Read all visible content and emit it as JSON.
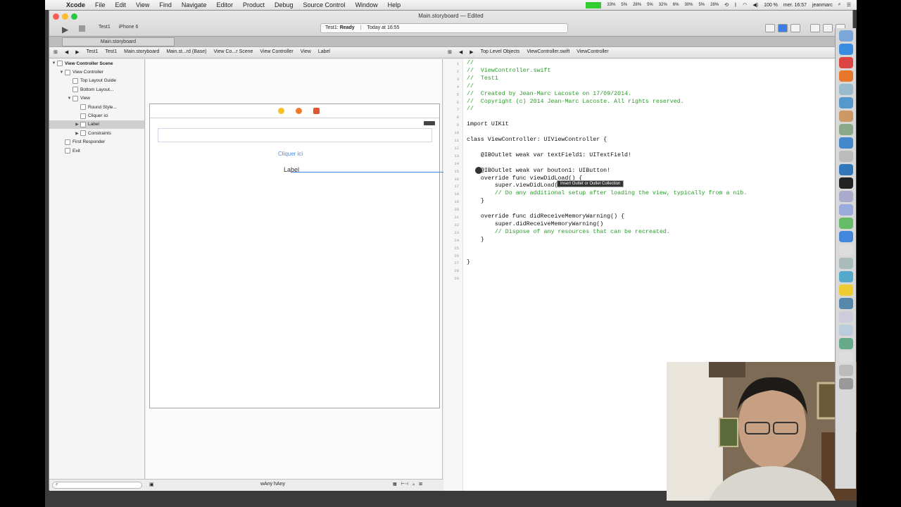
{
  "menubar": {
    "app": "Xcode",
    "items": [
      "File",
      "Edit",
      "View",
      "Find",
      "Navigate",
      "Editor",
      "Product",
      "Debug",
      "Source Control",
      "Window",
      "Help"
    ],
    "cpu_meters": [
      "33%",
      "5%",
      "28%",
      "5%",
      "32%",
      "6%",
      "30%",
      "5%",
      "28%"
    ],
    "battery": "100 %",
    "clock": "mer. 16:57",
    "user": "jeanmarc"
  },
  "window": {
    "title": "Main.storyboard — Edited",
    "scheme_target": "Test1",
    "scheme_device": "iPhone 6",
    "activity_project": "Test1:",
    "activity_status": "Ready",
    "activity_time": "Today at 16:55",
    "tab_label": "Main.storyboard"
  },
  "jumpbar_left": [
    "Test1",
    "Test1",
    "Main.storyboard",
    "Main.st...rd (Base)",
    "View Co...r Scene",
    "View Controller",
    "View",
    "Label"
  ],
  "jumpbar_right": [
    "Top Level Objects",
    "ViewController.swift",
    "ViewController"
  ],
  "outline": [
    {
      "label": "View Controller Scene",
      "depth": 0,
      "tri": "▼",
      "bold": true
    },
    {
      "label": "View Controller",
      "depth": 1,
      "tri": "▼"
    },
    {
      "label": "Top Layout Guide",
      "depth": 2,
      "tri": ""
    },
    {
      "label": "Bottom Layout...",
      "depth": 2,
      "tri": ""
    },
    {
      "label": "View",
      "depth": 2,
      "tri": "▼"
    },
    {
      "label": "Round Style...",
      "depth": 3,
      "tri": ""
    },
    {
      "label": "Cliquer ici",
      "depth": 3,
      "tri": ""
    },
    {
      "label": "Label",
      "depth": 3,
      "tri": "▶",
      "selected": true
    },
    {
      "label": "Constraints",
      "depth": 3,
      "tri": "▶"
    },
    {
      "label": "First Responder",
      "depth": 1,
      "tri": ""
    },
    {
      "label": "Exit",
      "depth": 1,
      "tri": ""
    }
  ],
  "canvas": {
    "button_label": "Cliquer ici",
    "label_text": "Label"
  },
  "bottombar": {
    "size_class": "wAny hAny"
  },
  "code_lines": [
    {
      "n": "1",
      "t": "//",
      "c": "cm"
    },
    {
      "n": "2",
      "t": "//  ViewController.swift",
      "c": "cm"
    },
    {
      "n": "3",
      "t": "//  Test1",
      "c": "cm"
    },
    {
      "n": "4",
      "t": "//",
      "c": "cm"
    },
    {
      "n": "5",
      "t": "//  Created by Jean-Marc Lacoste on 17/09/2014.",
      "c": "cm"
    },
    {
      "n": "6",
      "t": "//  Copyright (c) 2014 Jean-Marc Lacoste. All rights reserved.",
      "c": "cm"
    },
    {
      "n": "7",
      "t": "//",
      "c": "cm"
    },
    {
      "n": "8",
      "t": "",
      "c": ""
    },
    {
      "n": "9",
      "t": "import UIKit",
      "c": ""
    },
    {
      "n": "10",
      "t": "",
      "c": ""
    },
    {
      "n": "11",
      "t": "class ViewController: UIViewController {",
      "c": ""
    },
    {
      "n": "12",
      "t": "",
      "c": ""
    },
    {
      "n": "13",
      "t": "    @IBOutlet weak var textField1: UITextField!",
      "c": ""
    },
    {
      "n": "14",
      "t": "",
      "c": ""
    },
    {
      "n": "15",
      "t": "    @IBOutlet weak var bouton1: UIButton!",
      "c": ""
    },
    {
      "n": "16",
      "t": "    override func viewDidLoad() {",
      "c": ""
    },
    {
      "n": "17",
      "t": "        super.viewDidLoad()",
      "c": ""
    },
    {
      "n": "18",
      "t": "        // Do any additional setup after loading the view, typically from a nib.",
      "c": "cm"
    },
    {
      "n": "19",
      "t": "    }",
      "c": ""
    },
    {
      "n": "20",
      "t": "",
      "c": ""
    },
    {
      "n": "21",
      "t": "    override func didReceiveMemoryWarning() {",
      "c": ""
    },
    {
      "n": "22",
      "t": "        super.didReceiveMemoryWarning()",
      "c": ""
    },
    {
      "n": "23",
      "t": "        // Dispose of any resources that can be recreated.",
      "c": "cm"
    },
    {
      "n": "24",
      "t": "    }",
      "c": ""
    },
    {
      "n": "25",
      "t": "",
      "c": ""
    },
    {
      "n": "26",
      "t": "",
      "c": ""
    },
    {
      "n": "27",
      "t": "}",
      "c": ""
    },
    {
      "n": "28",
      "t": "",
      "c": ""
    },
    {
      "n": "29",
      "t": "",
      "c": ""
    }
  ],
  "tooltip": "Insert Outlet or Outlet Collection",
  "colors": {
    "comment": "#2a9a2a",
    "keyword": "#b0219a",
    "type": "#4e8dc7",
    "link": "#4a8be0"
  }
}
